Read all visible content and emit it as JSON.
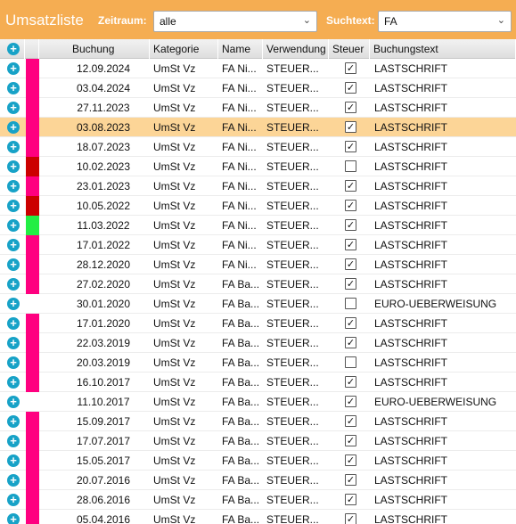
{
  "toolbar": {
    "title": "Umsatzliste",
    "zeitraum_label": "Zeitraum:",
    "zeitraum_value": "alle",
    "suchtext_label": "Suchtext:",
    "suchtext_value": "FA"
  },
  "table": {
    "columns": [
      "Buchung",
      "Kategorie",
      "Name",
      "Verwendung",
      "Steuer",
      "Buchungstext"
    ],
    "rows": [
      {
        "color": "#ff0080",
        "date": "12.09.2024",
        "kategorie": "UmSt Vz",
        "name": "FA Ni...",
        "verwendung": "STEUER...",
        "steuer": true,
        "text": "LASTSCHRIFT"
      },
      {
        "color": "#ff0080",
        "date": "03.04.2024",
        "kategorie": "UmSt Vz",
        "name": "FA Ni...",
        "verwendung": "STEUER...",
        "steuer": true,
        "text": "LASTSCHRIFT"
      },
      {
        "color": "#ff0080",
        "date": "27.11.2023",
        "kategorie": "UmSt Vz",
        "name": "FA Ni...",
        "verwendung": "STEUER...",
        "steuer": true,
        "text": "LASTSCHRIFT"
      },
      {
        "color": "#ff0080",
        "date": "03.08.2023",
        "kategorie": "UmSt Vz",
        "name": "FA Ni...",
        "verwendung": "STEUER...",
        "steuer": true,
        "text": "LASTSCHRIFT",
        "selected": true
      },
      {
        "color": "#ff0080",
        "date": "18.07.2023",
        "kategorie": "UmSt Vz",
        "name": "FA Ni...",
        "verwendung": "STEUER...",
        "steuer": true,
        "text": "LASTSCHRIFT"
      },
      {
        "color": "#cc0000",
        "date": "10.02.2023",
        "kategorie": "UmSt Vz",
        "name": "FA Ni...",
        "verwendung": "STEUER...",
        "steuer": false,
        "text": "LASTSCHRIFT"
      },
      {
        "color": "#ff0080",
        "date": "23.01.2023",
        "kategorie": "UmSt Vz",
        "name": "FA Ni...",
        "verwendung": "STEUER...",
        "steuer": true,
        "text": "LASTSCHRIFT"
      },
      {
        "color": "#cc0000",
        "date": "10.05.2022",
        "kategorie": "UmSt Vz",
        "name": "FA Ni...",
        "verwendung": "STEUER...",
        "steuer": true,
        "text": "LASTSCHRIFT"
      },
      {
        "color": "#22ee44",
        "date": "11.03.2022",
        "kategorie": "UmSt Vz",
        "name": "FA Ni...",
        "verwendung": "STEUER...",
        "steuer": true,
        "text": "LASTSCHRIFT"
      },
      {
        "color": "#ff0080",
        "date": "17.01.2022",
        "kategorie": "UmSt Vz",
        "name": "FA Ni...",
        "verwendung": "STEUER...",
        "steuer": true,
        "text": "LASTSCHRIFT"
      },
      {
        "color": "#ff0080",
        "date": "28.12.2020",
        "kategorie": "UmSt Vz",
        "name": "FA Ni...",
        "verwendung": "STEUER...",
        "steuer": true,
        "text": "LASTSCHRIFT"
      },
      {
        "color": "#ff0080",
        "date": "27.02.2020",
        "kategorie": "UmSt Vz",
        "name": "FA Ba...",
        "verwendung": "STEUER...",
        "steuer": true,
        "text": "LASTSCHRIFT"
      },
      {
        "color": "",
        "date": "30.01.2020",
        "kategorie": "UmSt Vz",
        "name": "FA Ba...",
        "verwendung": "STEUER...",
        "steuer": false,
        "text": "EURO-UEBERWEISUNG"
      },
      {
        "color": "#ff0080",
        "date": "17.01.2020",
        "kategorie": "UmSt Vz",
        "name": "FA Ba...",
        "verwendung": "STEUER...",
        "steuer": true,
        "text": "LASTSCHRIFT"
      },
      {
        "color": "#ff0080",
        "date": "22.03.2019",
        "kategorie": "UmSt Vz",
        "name": "FA Ba...",
        "verwendung": "STEUER...",
        "steuer": true,
        "text": "LASTSCHRIFT"
      },
      {
        "color": "#ff0080",
        "date": "20.03.2019",
        "kategorie": "UmSt Vz",
        "name": "FA Ba...",
        "verwendung": "STEUER...",
        "steuer": false,
        "text": "LASTSCHRIFT"
      },
      {
        "color": "#ff0080",
        "date": "16.10.2017",
        "kategorie": "UmSt Vz",
        "name": "FA Ba...",
        "verwendung": "STEUER...",
        "steuer": true,
        "text": "LASTSCHRIFT"
      },
      {
        "color": "",
        "date": "11.10.2017",
        "kategorie": "UmSt Vz",
        "name": "FA Ba...",
        "verwendung": "STEUER...",
        "steuer": true,
        "text": "EURO-UEBERWEISUNG"
      },
      {
        "color": "#ff0080",
        "date": "15.09.2017",
        "kategorie": "UmSt Vz",
        "name": "FA Ba...",
        "verwendung": "STEUER...",
        "steuer": true,
        "text": "LASTSCHRIFT"
      },
      {
        "color": "#ff0080",
        "date": "17.07.2017",
        "kategorie": "UmSt Vz",
        "name": "FA Ba...",
        "verwendung": "STEUER...",
        "steuer": true,
        "text": "LASTSCHRIFT"
      },
      {
        "color": "#ff0080",
        "date": "15.05.2017",
        "kategorie": "UmSt Vz",
        "name": "FA Ba...",
        "verwendung": "STEUER...",
        "steuer": true,
        "text": "LASTSCHRIFT"
      },
      {
        "color": "#ff0080",
        "date": "20.07.2016",
        "kategorie": "UmSt Vz",
        "name": "FA Ba...",
        "verwendung": "STEUER...",
        "steuer": true,
        "text": "LASTSCHRIFT"
      },
      {
        "color": "#ff0080",
        "date": "28.06.2016",
        "kategorie": "UmSt Vz",
        "name": "FA Ba...",
        "verwendung": "STEUER...",
        "steuer": true,
        "text": "LASTSCHRIFT"
      },
      {
        "color": "#ff0080",
        "date": "05.04.2016",
        "kategorie": "UmSt Vz",
        "name": "FA Ba...",
        "verwendung": "STEUER...",
        "steuer": true,
        "text": "LASTSCHRIFT"
      }
    ]
  },
  "icons": {
    "add": "plus-circle-icon",
    "dropdown": "chevron-down-icon",
    "check": "checkbox-icon"
  }
}
